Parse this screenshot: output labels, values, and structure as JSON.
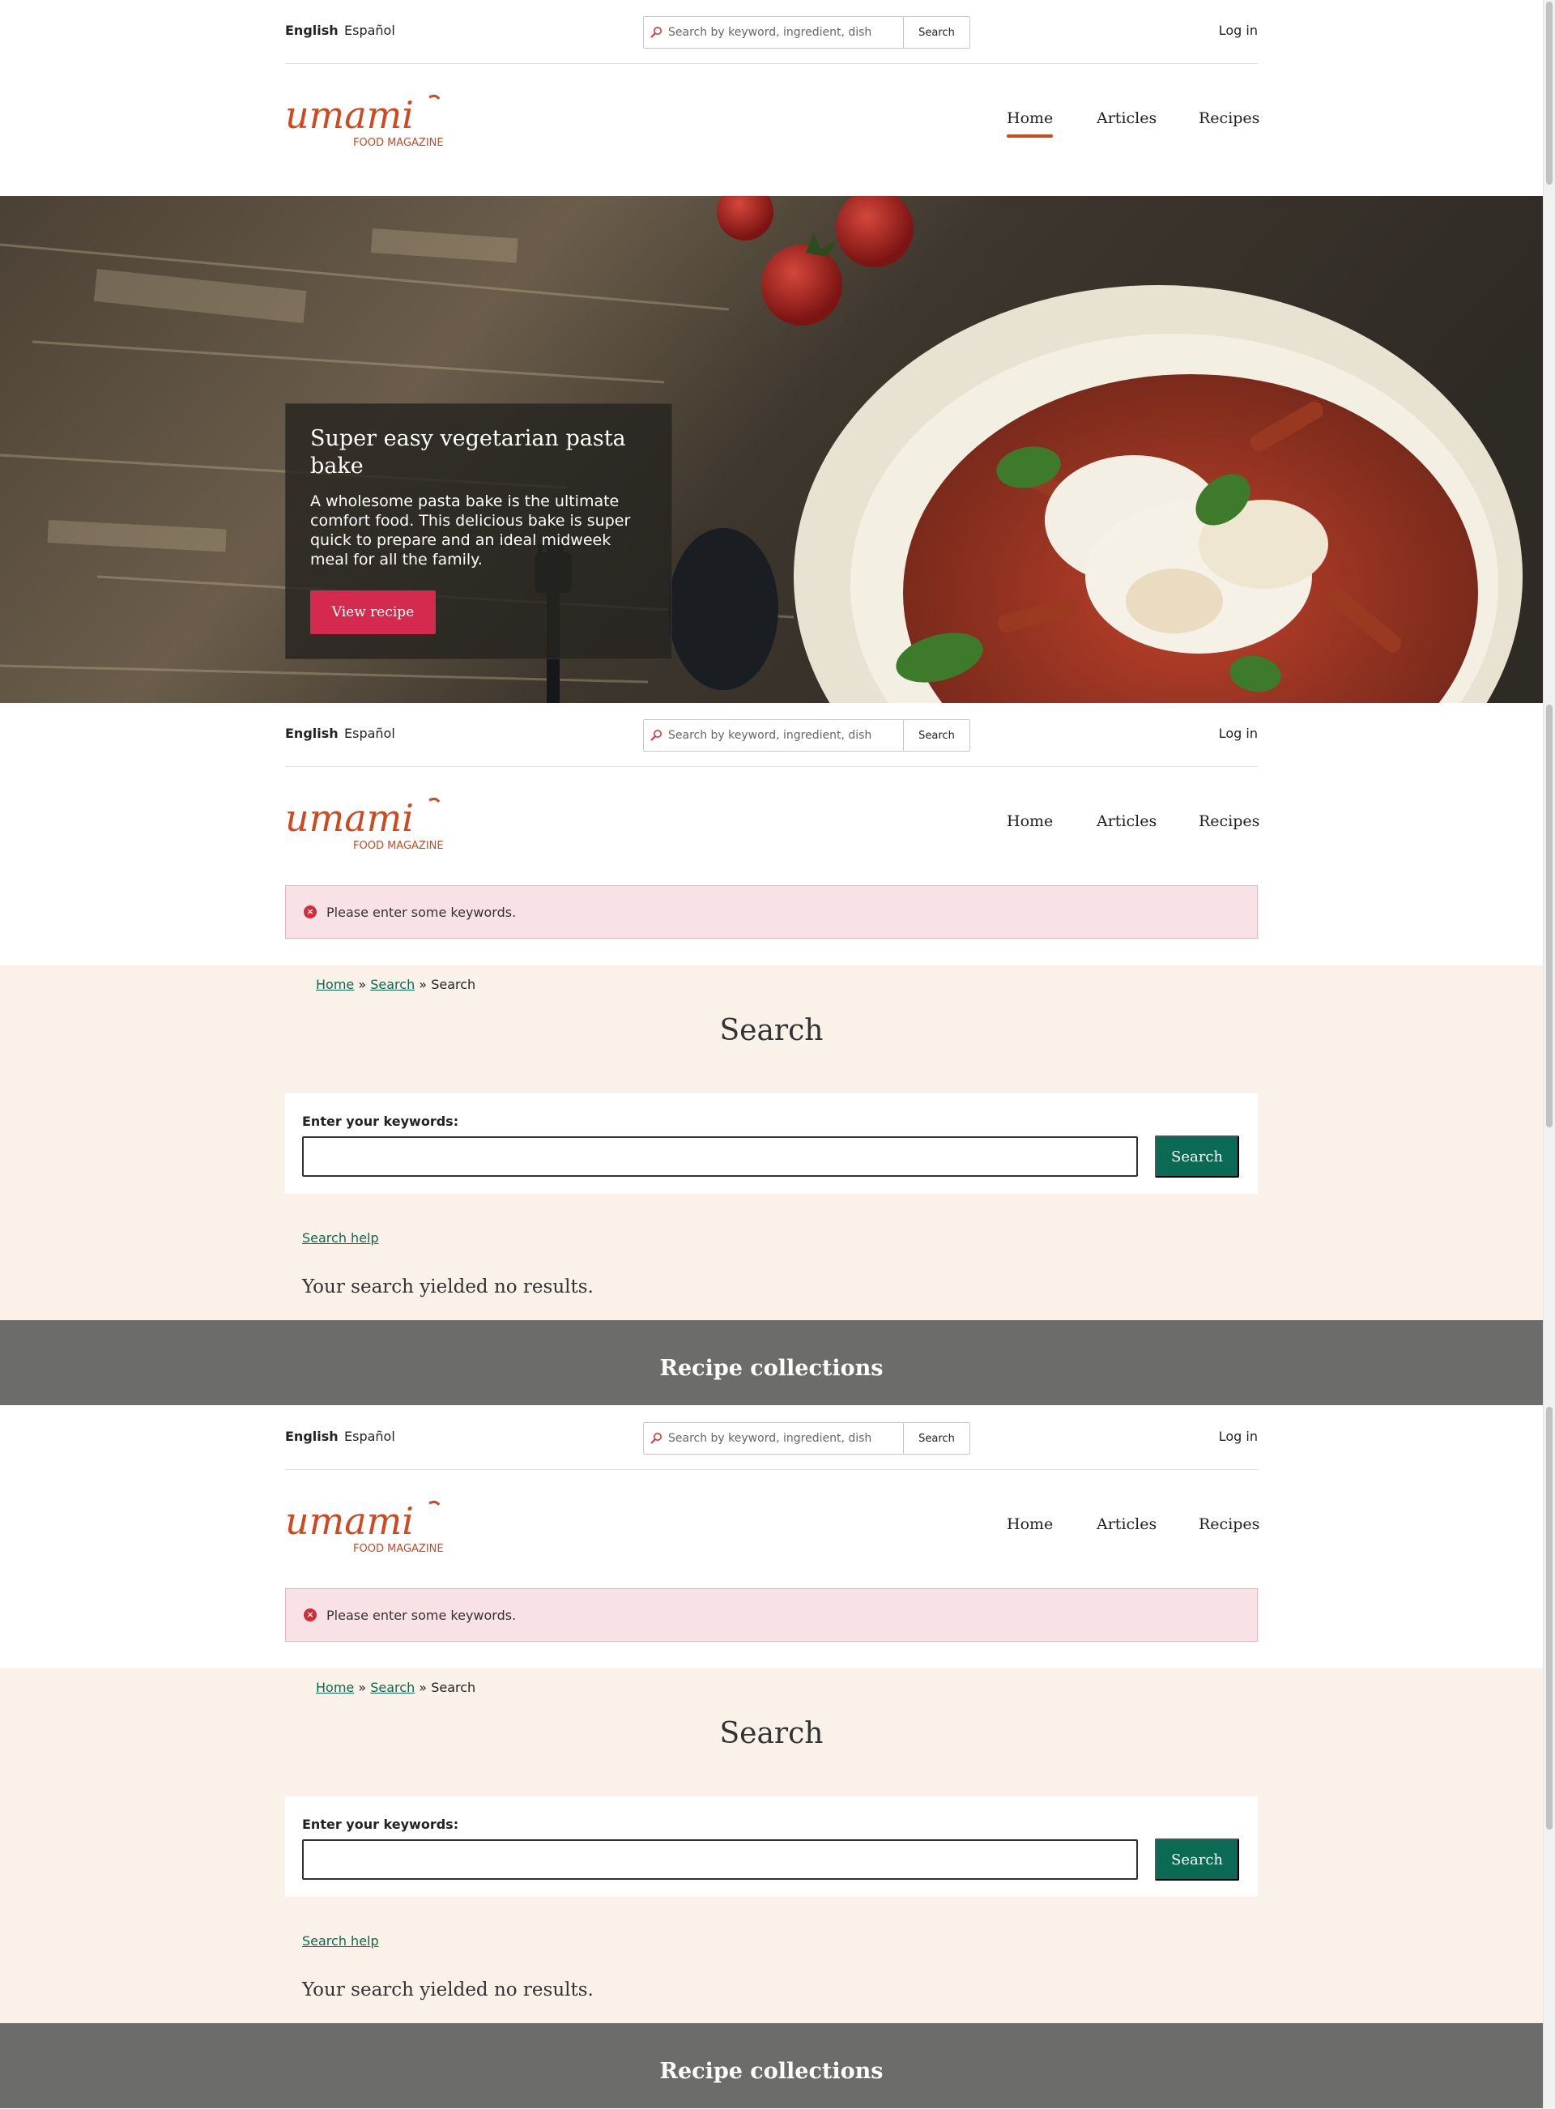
{
  "header": {
    "lang_active": "English",
    "lang_alt": "Español",
    "search_placeholder": "Search by keyword, ingredient, dish",
    "search_button": "Search",
    "login": "Log in",
    "logo_word": "umami",
    "logo_sub": "FOOD MAGAZINE",
    "nav": {
      "home": "Home",
      "articles": "Articles",
      "recipes": "Recipes"
    }
  },
  "hero": {
    "title": "Super easy vegetarian pasta bake",
    "text": "A wholesome pasta bake is the ultimate comfort food. This delicious bake is super quick to prepare and an ideal midweek meal for all the family.",
    "button": "View recipe"
  },
  "message": {
    "error": "Please enter some keywords."
  },
  "search_page": {
    "breadcrumb": {
      "home": "Home",
      "search": "Search",
      "current": "Search",
      "separator": "»"
    },
    "title": "Search",
    "label": "Enter your keywords:",
    "button": "Search",
    "help": "Search help",
    "no_results": "Your search yielded no results."
  },
  "collections": {
    "title": "Recipe collections"
  },
  "colors": {
    "brand": "#d0481f",
    "accent_green": "#0b6a53",
    "hero_button": "#d42a4d",
    "error_bg": "#f9e2e6",
    "content_bg": "#faf1e9",
    "collections_bg": "#6c6c6a"
  }
}
